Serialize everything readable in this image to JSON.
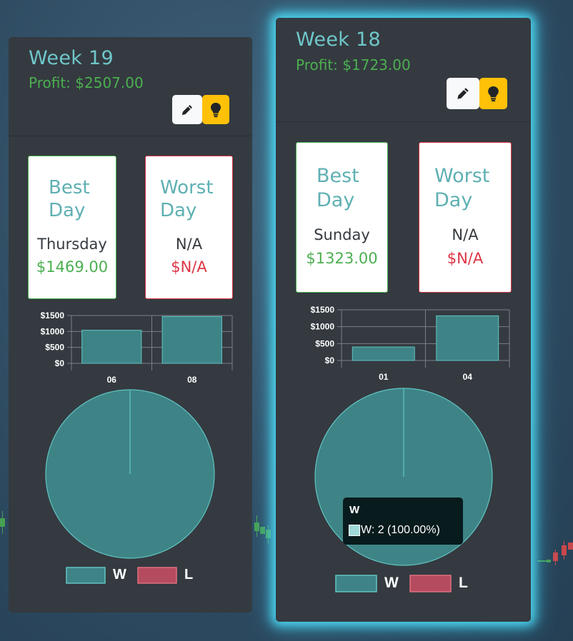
{
  "colors": {
    "card_bg": "#343a40",
    "title": "#6fc7c9",
    "profit": "#4caf50",
    "negative": "#dc3545",
    "win_fill": "#3e8486",
    "win_stroke": "#62c3c3",
    "loss_fill": "#b54b5f",
    "loss_stroke": "#e0707f",
    "edit_button": "#f8f9fa",
    "tip_button": "#ffc107",
    "glow": "#50e6ff"
  },
  "cards": {
    "week19": {
      "title": "Week 19",
      "profit": "Profit: $2507.00",
      "edit_icon": "pencil-icon",
      "tip_icon": "lightbulb-icon",
      "best": {
        "heading": "Best Day",
        "day": "Thursday",
        "value": "$1469.00"
      },
      "worst": {
        "heading": "Worst Day",
        "day": "N/A",
        "value": "$N/A"
      },
      "legend": {
        "win": "W",
        "loss": "L"
      }
    },
    "week18": {
      "title": "Week 18",
      "profit": "Profit: $1723.00",
      "edit_icon": "pencil-icon",
      "tip_icon": "lightbulb-icon",
      "best": {
        "heading": "Best Day",
        "day": "Sunday",
        "value": "$1323.00"
      },
      "worst": {
        "heading": "Worst Day",
        "day": "N/A",
        "value": "$N/A"
      },
      "legend": {
        "win": "W",
        "loss": "L"
      },
      "tooltip": {
        "title": "W",
        "text": "W: 2 (100.00%)"
      }
    }
  },
  "chart_data": [
    {
      "type": "bar",
      "card": "week19",
      "categories": [
        "06",
        "08"
      ],
      "values": [
        1038,
        1469
      ],
      "yticks": [
        "$1500",
        "$1000",
        "$500",
        "$0"
      ],
      "ylim": [
        0,
        1500
      ],
      "grid": true
    },
    {
      "type": "pie",
      "card": "week19",
      "labels": [
        "W",
        "L"
      ],
      "values": [
        2,
        0
      ]
    },
    {
      "type": "bar",
      "card": "week18",
      "categories": [
        "01",
        "04"
      ],
      "values": [
        400,
        1323
      ],
      "yticks": [
        "$1500",
        "$1000",
        "$500",
        "$0"
      ],
      "ylim": [
        0,
        1500
      ],
      "grid": true
    },
    {
      "type": "pie",
      "card": "week18",
      "labels": [
        "W",
        "L"
      ],
      "values": [
        2,
        0
      ]
    }
  ]
}
